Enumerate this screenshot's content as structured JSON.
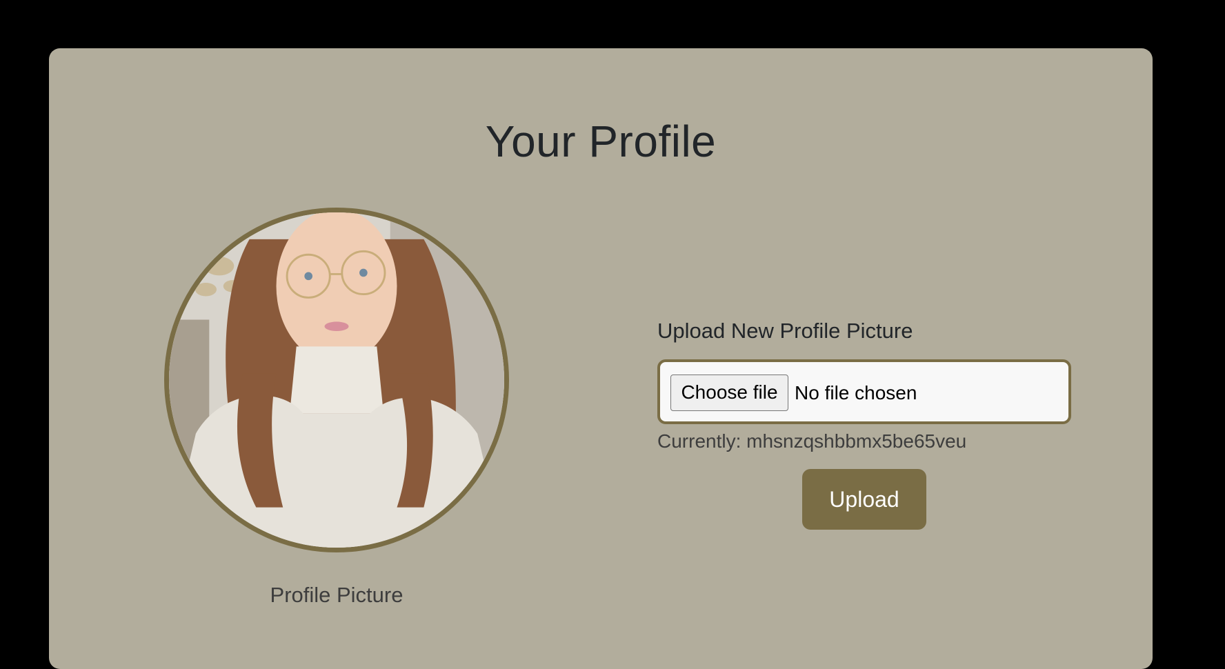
{
  "page": {
    "title": "Your Profile"
  },
  "profile_picture": {
    "caption": "Profile Picture",
    "border_color": "#7a6d45"
  },
  "upload_form": {
    "label": "Upload New Profile Picture",
    "choose_file_label": "Choose file",
    "file_status": "No file chosen",
    "current_file": "Currently: mhsnzqshbbmx5be65veu",
    "submit_label": "Upload"
  },
  "colors": {
    "background": "#000000",
    "card": "#b2ad9c",
    "accent": "#7a6d45"
  }
}
